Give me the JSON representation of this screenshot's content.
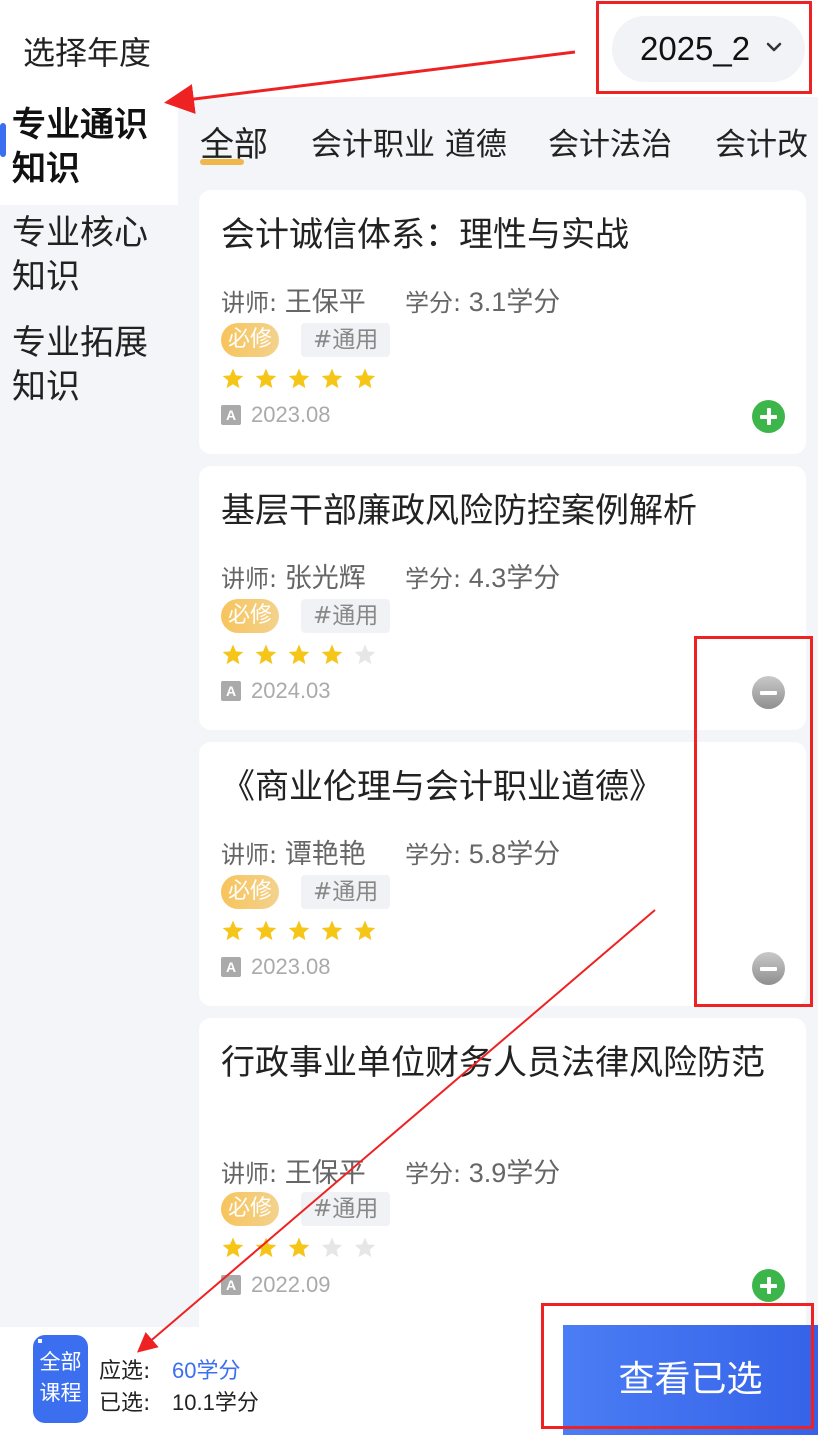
{
  "header": {
    "year_label": "选择年度",
    "year_value": "2025_2"
  },
  "sidebar": {
    "items": [
      {
        "label_line1": "专业通识",
        "label_line2": "知识",
        "active": true
      },
      {
        "label_line1": "专业核心",
        "label_line2": "知识",
        "active": false
      },
      {
        "label_line1": "专业拓展",
        "label_line2": "知识",
        "active": false
      }
    ]
  },
  "tabs": [
    "全部",
    "会计职业 道德",
    "会计法治",
    "会计改"
  ],
  "courses": [
    {
      "title": "会计诚信体系：理性与实战",
      "lecturer_label": "讲师:",
      "lecturer": "王保平",
      "credit_label": "学分:",
      "credit": "3.1学分",
      "required": "必修",
      "tag": "#通用",
      "rating": 5,
      "date": "2023.08",
      "action": "add"
    },
    {
      "title": "基层干部廉政风险防控案例解析",
      "lecturer_label": "讲师:",
      "lecturer": "张光辉",
      "credit_label": "学分:",
      "credit": "4.3学分",
      "required": "必修",
      "tag": "#通用",
      "rating": 4,
      "date": "2024.03",
      "action": "remove"
    },
    {
      "title": "《商业伦理与会计职业道德》",
      "lecturer_label": "讲师:",
      "lecturer": "谭艳艳",
      "credit_label": "学分:",
      "credit": "5.8学分",
      "required": "必修",
      "tag": "#通用",
      "rating": 5,
      "date": "2023.08",
      "action": "remove"
    },
    {
      "title": "行政事业单位财务人员法律风险防范",
      "lecturer_label": "讲师:",
      "lecturer": "王保平",
      "credit_label": "学分:",
      "credit": "3.9学分",
      "required": "必修",
      "tag": "#通用",
      "rating": 3,
      "date": "2022.09",
      "action": "add"
    }
  ],
  "footer": {
    "all_courses_line1": "全部",
    "all_courses_line2": "课程",
    "should_select_label": "应选:",
    "should_select_value": "60学分",
    "selected_label": "已选:",
    "selected_value": "10.1学分",
    "view_selected_label": "查看已选"
  },
  "colors": {
    "accent": "#3b6ff0",
    "star": "#f5c518",
    "star_empty": "#e6e6e6",
    "annotation": "#e22222"
  }
}
